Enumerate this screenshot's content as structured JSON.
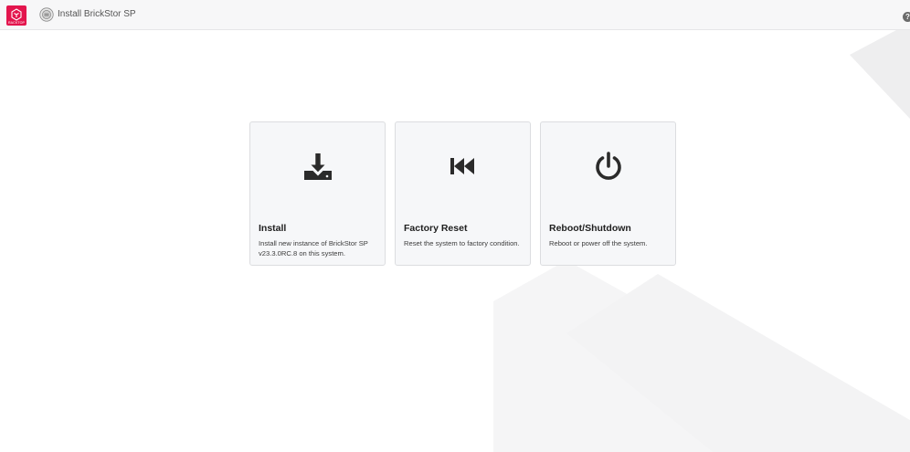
{
  "header": {
    "logo_text": "RACKTOP",
    "app_title": "Install BrickStor SP",
    "help_icon": "?"
  },
  "cards": [
    {
      "title": "Install",
      "description": "Install new instance of BrickStor SP v23.3.0RC.8 on this system.",
      "icon": "download-icon"
    },
    {
      "title": "Factory Reset",
      "description": "Reset the system to factory condition.",
      "icon": "fast-backward-icon"
    },
    {
      "title": "Reboot/Shutdown",
      "description": "Reboot or power off the system.",
      "icon": "power-icon"
    }
  ],
  "colors": {
    "brand": "#e3154d",
    "card_bg": "#f6f7f9",
    "icon": "#2b2b2b"
  }
}
